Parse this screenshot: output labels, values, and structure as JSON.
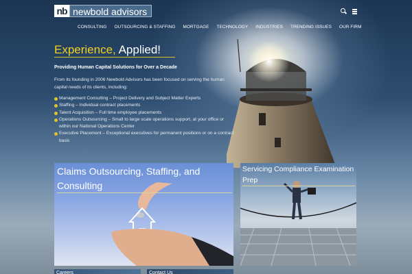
{
  "header": {
    "logo_mark": "nb",
    "logo_name": "newbold advisors",
    "icons": [
      "search-icon",
      "menu-icon"
    ]
  },
  "nav": {
    "items": [
      "CONSULTING",
      "OUTSOURCING & STAFFING",
      "MORTGAGE",
      "TECHNOLOGY",
      "INDUSTRIES",
      "TRENDING ISSUES",
      "OUR FIRM"
    ]
  },
  "hero": {
    "title_part1": "Experience,",
    "title_part2": "Applied!",
    "subhead": "Providing Human Capital Solutions for Over a Decade",
    "intro": "From its founding in 2006 Newbold Advisors has been focused on serving the human capital needs of its clients, including:",
    "services": [
      "Management Consulting – Project Delivery and Subject Matter Experts",
      "Staffing – Individual contract placements",
      "Talent Acquisition – Full time employee placements",
      "Operations Outsourcing – Small to large scale operations support, at your office or within our National Operations Center",
      "Executive Placement – Exceptional executives for permanent positions or on a contract basis"
    ]
  },
  "cards": [
    {
      "title": "Claims Outsourcing, Staffing, and Consulting"
    },
    {
      "title": "Servicing Compliance Examination Prep"
    }
  ],
  "tabs": {
    "careers": "Careers",
    "contact": "Contact Us"
  },
  "colors": {
    "accent": "#f2d021",
    "nav_text": "#ffffff",
    "logo_bg": "#4a6b8c"
  }
}
